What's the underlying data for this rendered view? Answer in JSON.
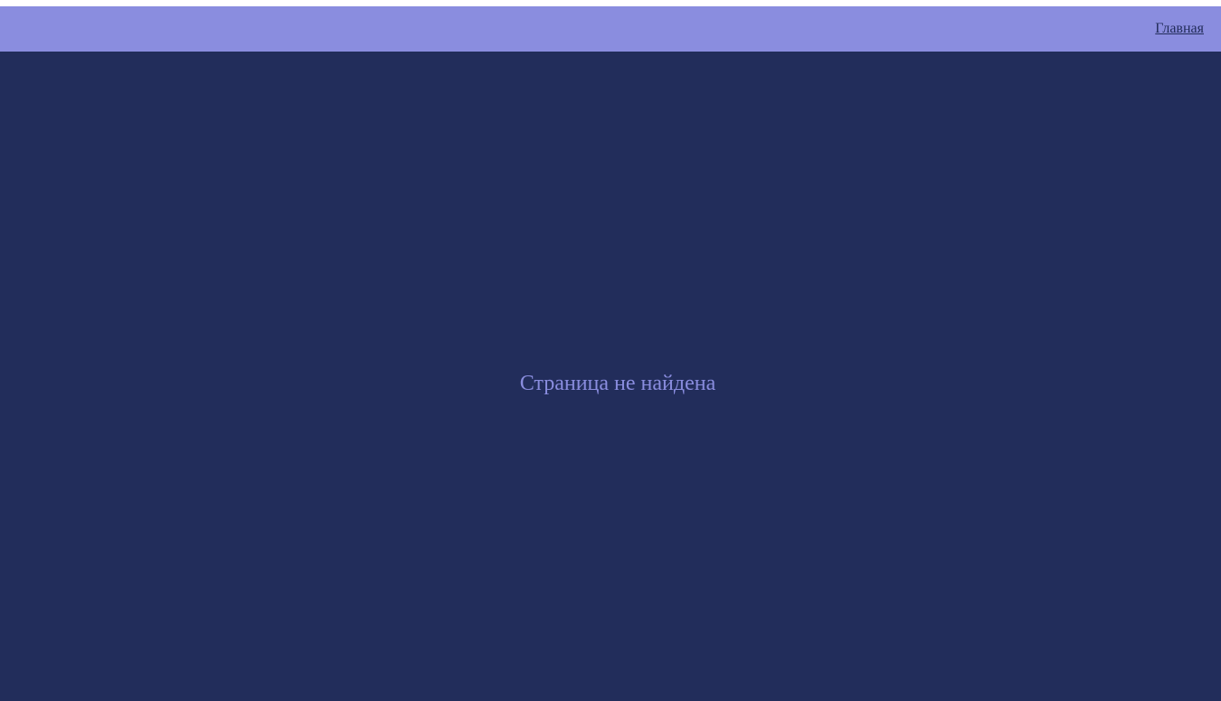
{
  "header": {
    "nav_home_label": "Главная"
  },
  "main": {
    "message": "Страница не найдена"
  },
  "colors": {
    "header_background": "#8a8ddf",
    "page_background": "#222d5b",
    "message_text": "#8a8ddf",
    "link_text": "#222c5a"
  }
}
